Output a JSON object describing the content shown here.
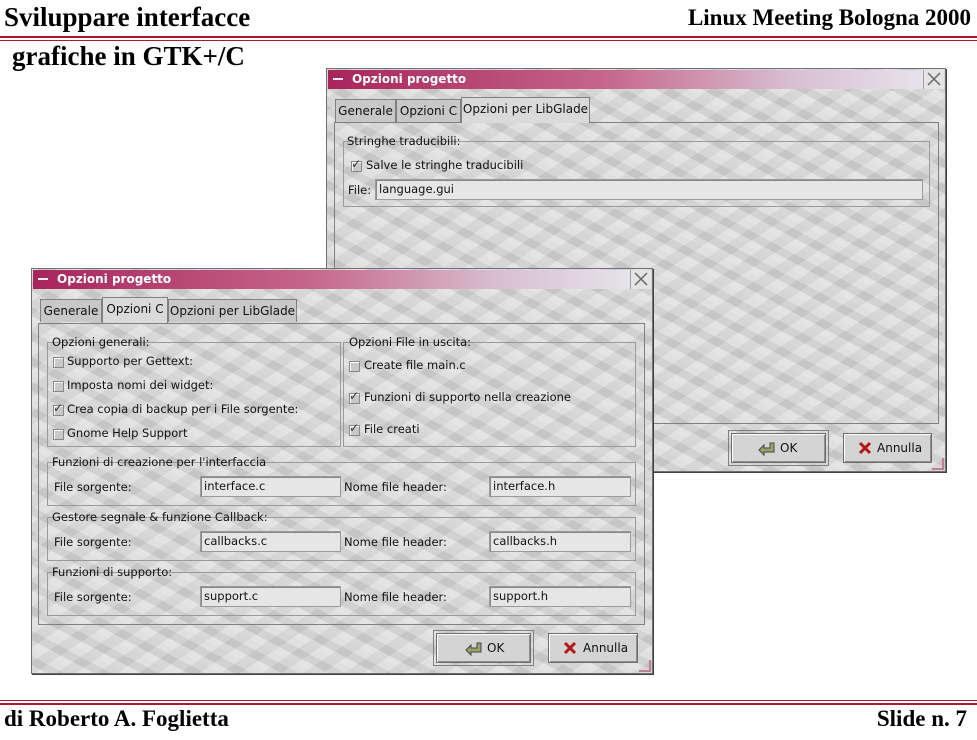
{
  "slide": {
    "title_line1": "Sviluppare interfacce",
    "title_line2": "grafiche in GTK+/C",
    "event": "Linux Meeting Bologna 2000",
    "author": "di Roberto A. Foglietta",
    "slide_number": "Slide n. 7"
  },
  "colors": {
    "rule": "#b0182c",
    "titlebar_start": "#a8245c"
  },
  "back_window": {
    "title": "Opzioni progetto",
    "tabs": [
      "Generale",
      "Opzioni C",
      "Opzioni per LibGlade"
    ],
    "active_tab": "Opzioni per LibGlade",
    "frame_label": "Stringhe traducibili:",
    "checkbox_label": "Salve le stringhe traducibili",
    "checkbox_checked": true,
    "file_label": "File:",
    "file_value": "language.gui",
    "ok_label": "OK",
    "cancel_label": "Annulla"
  },
  "front_window": {
    "title": "Opzioni progetto",
    "tabs": [
      "Generale",
      "Opzioni C",
      "Opzioni per LibGlade"
    ],
    "active_tab": "Opzioni C",
    "general": {
      "label": "Opzioni generali:",
      "items": [
        {
          "label": "Supporto per Gettext:",
          "checked": false
        },
        {
          "label": "Imposta nomi dei widget:",
          "checked": false
        },
        {
          "label": "Crea copia di backup per i File sorgente:",
          "checked": true
        },
        {
          "label": "Gnome Help Support",
          "checked": false
        }
      ]
    },
    "output": {
      "label": "Opzioni File in uscita:",
      "items": [
        {
          "label": "Create file main.c",
          "checked": false
        },
        {
          "label": "Funzioni di supporto nella creazione",
          "checked": true
        },
        {
          "label": "File creati",
          "checked": true
        }
      ]
    },
    "sections": [
      {
        "label": "Funzioni di creazione per l'interfaccia",
        "source_label": "File sorgente:",
        "source_value": "interface.c",
        "header_label": "Nome file header:",
        "header_value": "interface.h"
      },
      {
        "label": "Gestore segnale & funzione Callback:",
        "source_label": "File sorgente:",
        "source_value": "callbacks.c",
        "header_label": "Nome file header:",
        "header_value": "callbacks.h"
      },
      {
        "label": "Funzioni di supporto:",
        "source_label": "File sorgente:",
        "source_value": "support.c",
        "header_label": "Nome file header:",
        "header_value": "support.h"
      }
    ],
    "ok_label": "OK",
    "cancel_label": "Annulla"
  }
}
